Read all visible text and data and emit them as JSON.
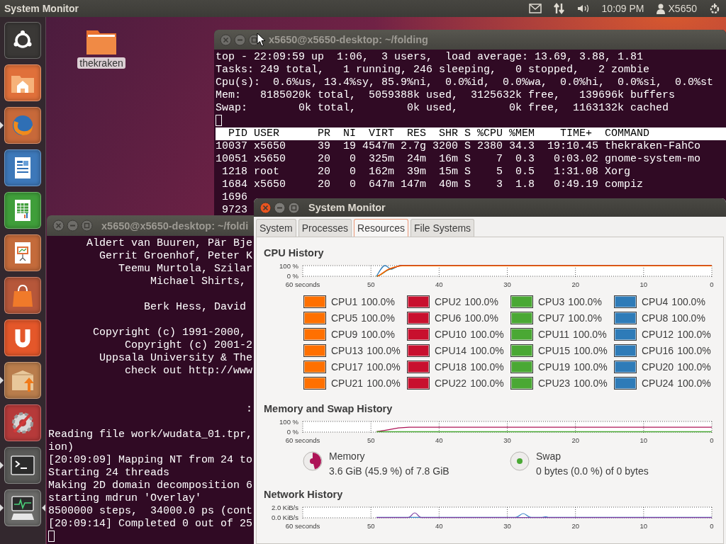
{
  "top_panel": {
    "title": "System Monitor",
    "clock": "10:09 PM",
    "user": "X5650"
  },
  "launcher": [
    {
      "running": false,
      "focused": false
    },
    {
      "running": false,
      "focused": false
    },
    {
      "running": true,
      "focused": false
    },
    {
      "running": false,
      "focused": false
    },
    {
      "running": false,
      "focused": false
    },
    {
      "running": false,
      "focused": false
    },
    {
      "running": false,
      "focused": false
    },
    {
      "running": false,
      "focused": false
    },
    {
      "running": true,
      "focused": false
    },
    {
      "running": false,
      "focused": false
    },
    {
      "running": true,
      "focused": false
    },
    {
      "running": true,
      "focused": true
    }
  ],
  "desktop_icons": [
    {
      "label": "thekraken",
      "selected": true
    }
  ],
  "terminal_top": {
    "title": "x5650@x5650-desktop: ~/folding",
    "focused": false,
    "lines": [
      {
        "kind": "text",
        "text": "top - 22:09:59 up  1:06,  3 users,  load average: 13.69, 3.88, 1.81"
      },
      {
        "kind": "text",
        "text": "Tasks: 249 total,   1 running, 246 sleeping,   0 stopped,   2 zombie"
      },
      {
        "kind": "text",
        "text": "Cpu(s):  0.6%us, 13.4%sy, 85.9%ni,  0.0%id,  0.0%wa,  0.0%hi,  0.0%si,  0.0%st"
      },
      {
        "kind": "text",
        "text": "Mem:   8185020k total,  5059388k used,  3125632k free,   139696k buffers"
      },
      {
        "kind": "text",
        "text": "Swap:        0k total,        0k used,        0k free,  1163132k cached"
      },
      {
        "kind": "cursor"
      },
      {
        "kind": "header",
        "text": "  PID USER      PR  NI  VIRT  RES  SHR S %CPU %MEM    TIME+  COMMAND"
      },
      {
        "kind": "text",
        "text": "10037 x5650     39  19 4547m 2.7g 3200 S 2380 34.3  19:10.45 thekraken-FahCo"
      },
      {
        "kind": "text",
        "text": "10051 x5650     20   0  325m  24m  16m S    7  0.3   0:03.02 gnome-system-mo"
      },
      {
        "kind": "text",
        "text": " 1218 root      20   0  162m  39m  15m S    5  0.5   1:31.08 Xorg"
      },
      {
        "kind": "text",
        "text": " 1684 x5650     20   0  647m 147m  40m S    3  1.8   0:49.19 compiz"
      },
      {
        "kind": "text",
        "text": " 1696"
      },
      {
        "kind": "text",
        "text": " 9723"
      }
    ]
  },
  "terminal_bottom": {
    "title": "x5650@x5650-desktop: ~/foldi",
    "focused": false,
    "lines": [
      {
        "kind": "text",
        "text": "      Aldert van Buuren, Pär Bje"
      },
      {
        "kind": "text",
        "text": "        Gerrit Groenhof, Peter K"
      },
      {
        "kind": "text",
        "text": "           Teemu Murtola, Szilar"
      },
      {
        "kind": "text",
        "text": "                Michael Shirts,"
      },
      {
        "kind": "blank"
      },
      {
        "kind": "text",
        "text": "               Berk Hess, David"
      },
      {
        "kind": "blank"
      },
      {
        "kind": "text",
        "text": "       Copyright (c) 1991-2000,"
      },
      {
        "kind": "text",
        "text": "            Copyright (c) 2001-2"
      },
      {
        "kind": "text",
        "text": "        Uppsala University & The"
      },
      {
        "kind": "text",
        "text": "            check out http://www"
      },
      {
        "kind": "blank"
      },
      {
        "kind": "blank"
      },
      {
        "kind": "text",
        "text": "                               :"
      },
      {
        "kind": "blank"
      },
      {
        "kind": "text",
        "text": "Reading file work/wudata_01.tpr,"
      },
      {
        "kind": "text",
        "text": "ion)"
      },
      {
        "kind": "text",
        "text": "[20:09:09] Mapping NT from 24 to"
      },
      {
        "kind": "text",
        "text": "Starting 24 threads"
      },
      {
        "kind": "text",
        "text": "Making 2D domain decomposition 6"
      },
      {
        "kind": "text",
        "text": "starting mdrun 'Overlay'"
      },
      {
        "kind": "text",
        "text": "8500000 steps,  34000.0 ps (cont"
      },
      {
        "kind": "text",
        "text": "[20:09:14] Completed 0 out of 25"
      },
      {
        "kind": "cursor"
      }
    ]
  },
  "system_monitor": {
    "title": "System Monitor",
    "focused": true,
    "tabs": [
      {
        "label": "System",
        "selected": false
      },
      {
        "label": "Processes",
        "selected": false
      },
      {
        "label": "Resources",
        "selected": true
      },
      {
        "label": "File Systems",
        "selected": false
      }
    ],
    "sections": [
      {
        "kind": "cpu",
        "title": "CPU History",
        "y_labels": [
          "100 %",
          "0 %"
        ],
        "x_labels": [
          "60 seconds",
          "50",
          "40",
          "30",
          "20",
          "10",
          "0"
        ],
        "legend": [
          {
            "name": "CPU1",
            "value": "100.0%",
            "color": "#ff7000"
          },
          {
            "name": "CPU2",
            "value": "100.0%",
            "color": "#c8102e"
          },
          {
            "name": "CPU3",
            "value": "100.0%",
            "color": "#4aa834"
          },
          {
            "name": "CPU4",
            "value": "100.0%",
            "color": "#2e7bb8"
          },
          {
            "name": "CPU5",
            "value": "100.0%",
            "color": "#ff7000"
          },
          {
            "name": "CPU6",
            "value": "100.0%",
            "color": "#c8102e"
          },
          {
            "name": "CPU7",
            "value": "100.0%",
            "color": "#4aa834"
          },
          {
            "name": "CPU8",
            "value": "100.0%",
            "color": "#2e7bb8"
          },
          {
            "name": "CPU9",
            "value": "100.0%",
            "color": "#ff7000"
          },
          {
            "name": "CPU10",
            "value": "100.0%",
            "color": "#c8102e"
          },
          {
            "name": "CPU11",
            "value": "100.0%",
            "color": "#4aa834"
          },
          {
            "name": "CPU12",
            "value": "100.0%",
            "color": "#2e7bb8"
          },
          {
            "name": "CPU13",
            "value": "100.0%",
            "color": "#ff7000"
          },
          {
            "name": "CPU14",
            "value": "100.0%",
            "color": "#c8102e"
          },
          {
            "name": "CPU15",
            "value": "100.0%",
            "color": "#4aa834"
          },
          {
            "name": "CPU16",
            "value": "100.0%",
            "color": "#2e7bb8"
          },
          {
            "name": "CPU17",
            "value": "100.0%",
            "color": "#ff7000"
          },
          {
            "name": "CPU18",
            "value": "100.0%",
            "color": "#c8102e"
          },
          {
            "name": "CPU19",
            "value": "100.0%",
            "color": "#4aa834"
          },
          {
            "name": "CPU20",
            "value": "100.0%",
            "color": "#2e7bb8"
          },
          {
            "name": "CPU21",
            "value": "100.0%",
            "color": "#ff7000"
          },
          {
            "name": "CPU22",
            "value": "100.0%",
            "color": "#c8102e"
          },
          {
            "name": "CPU23",
            "value": "100.0%",
            "color": "#4aa834"
          },
          {
            "name": "CPU24",
            "value": "100.0%",
            "color": "#2e7bb8"
          }
        ]
      },
      {
        "kind": "memory",
        "title": "Memory and Swap History",
        "y_labels": [
          "100 %",
          "0 %"
        ],
        "x_labels": [
          "60 seconds",
          "50",
          "40",
          "30",
          "20",
          "10",
          "0"
        ],
        "meters": [
          {
            "name": "Memory",
            "detail": "3.6 GiB (45.9 %) of 7.8 GiB",
            "level": 0.459,
            "color": "#ad1457"
          },
          {
            "name": "Swap",
            "detail": "0 bytes (0.0 %) of 0 bytes",
            "color": "#4aa834"
          }
        ]
      },
      {
        "kind": "network",
        "title": "Network History",
        "y_labels": [
          "2.0 KiB/s",
          "0.0 KiB/s"
        ],
        "x_labels": [
          "60 seconds",
          "50",
          "40",
          "30",
          "20",
          "10",
          "0"
        ]
      }
    ]
  }
}
